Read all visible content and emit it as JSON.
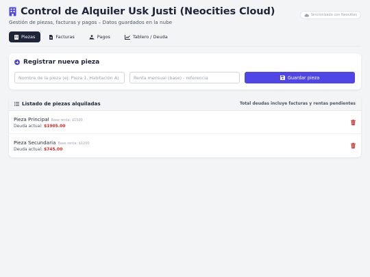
{
  "header": {
    "title": "Control de Alquiler Usk Justi (Neocities Cloud)",
    "subtitle": "Gestión de piezas, facturas y pagos – Datos guardados en la nube",
    "sync_status": "Sincronizado con Neocities"
  },
  "tabs": [
    {
      "label": "Piezas",
      "icon": "building-icon",
      "active": true
    },
    {
      "label": "Facturas",
      "icon": "file-icon",
      "active": false
    },
    {
      "label": "Pagos",
      "icon": "payment-icon",
      "active": false
    },
    {
      "label": "Tablero / Deuda",
      "icon": "chart-icon",
      "active": false
    }
  ],
  "register": {
    "title": "Registrar nueva pieza",
    "name_placeholder": "Nombre de la pieza (ej: Pieza 1, Habitación A)",
    "rent_placeholder": "Renta mensual (base) - referencia",
    "save_label": "Guardar pieza"
  },
  "list": {
    "title": "Listado de piezas alquiladas",
    "note": "Total deudas incluye facturas y rentas pendientes",
    "debt_label": "Deuda actual:",
    "items": [
      {
        "name": "Pieza Principal",
        "base": "Base renta: $1500",
        "debt": "$1905.00"
      },
      {
        "name": "Pieza Secundaria",
        "base": "Base renta: $1200",
        "debt": "$745.00"
      }
    ]
  },
  "colors": {
    "primary": "#4f46e5",
    "dark": "#1e2538",
    "danger": "#dc2626"
  }
}
